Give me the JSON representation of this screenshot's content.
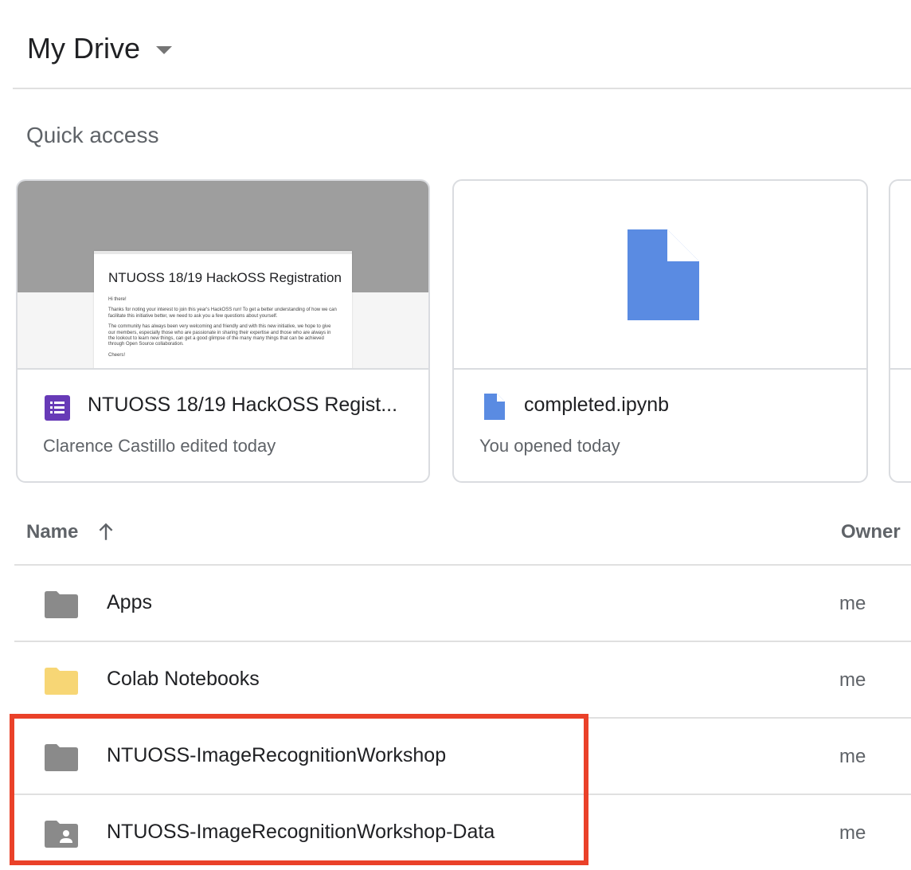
{
  "header": {
    "title": "My Drive"
  },
  "quick_access": {
    "heading": "Quick access",
    "cards": [
      {
        "name": "NTUOSS 18/19 HackOSS Regist...",
        "subtitle": "Clarence Castillo edited today",
        "icon": "forms-icon",
        "preview": {
          "title": "NTUOSS 18/19 HackOSS Registration",
          "lines": [
            "Hi there!",
            "Thanks for noting your interest to join this year's HackOSS run! To get a better understanding of how we can facilitate this initiative better, we need to ask you a few questions about yourself.",
            "The community has always been very welcoming and friendly and with this new initiative, we hope to give our members, especially those who are passionate in sharing their expertise and those who are always in the lookout to learn new things, can get a good glimpse of the many many things that can be achieved through Open Source collaboration.",
            "Cheers!"
          ]
        }
      },
      {
        "name": "completed.ipynb",
        "subtitle": "You opened today",
        "icon": "document-icon"
      }
    ]
  },
  "list": {
    "header": {
      "name": "Name",
      "owner": "Owner"
    },
    "rows": [
      {
        "name": "Apps",
        "owner": "me",
        "icon": "folder-icon",
        "color": "#8a8a8a"
      },
      {
        "name": "Colab Notebooks",
        "owner": "me",
        "icon": "folder-icon",
        "color": "#f7d675"
      },
      {
        "name": "NTUOSS-ImageRecognitionWorkshop",
        "owner": "me",
        "icon": "folder-icon",
        "color": "#8a8a8a"
      },
      {
        "name": "NTUOSS-ImageRecognitionWorkshop-Data",
        "owner": "me",
        "icon": "shared-folder-icon",
        "color": "#8a8a8a"
      }
    ]
  },
  "colors": {
    "highlight": "#ea4129",
    "forms_purple": "#673ab7",
    "doc_blue": "#5a8be2"
  }
}
